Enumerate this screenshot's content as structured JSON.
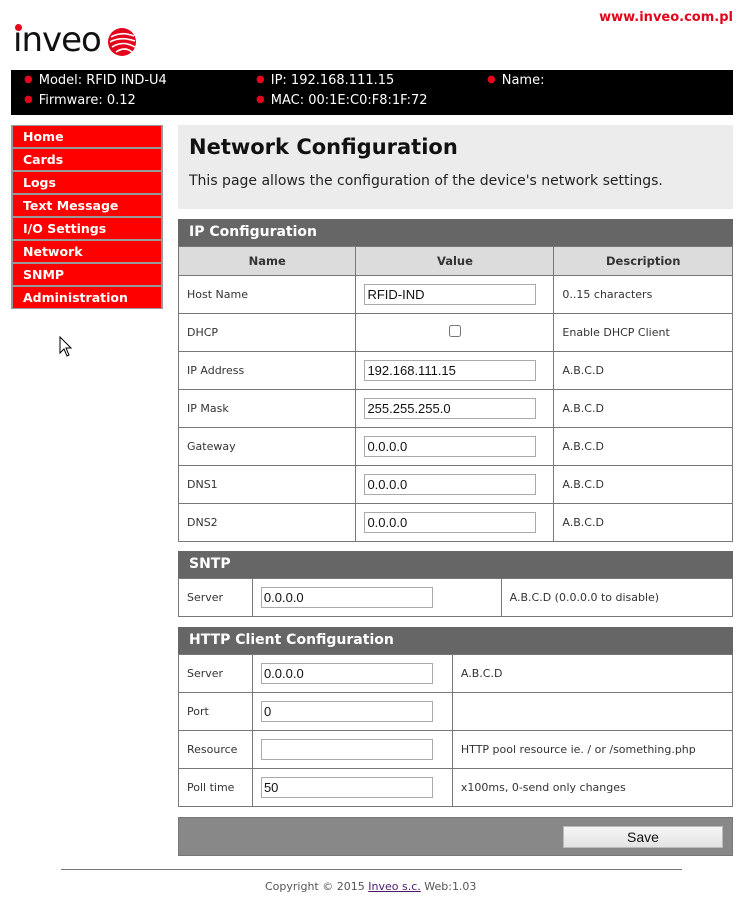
{
  "header": {
    "site_link": "www.inveo.com.pl",
    "logo_text": "inveo"
  },
  "device_info": {
    "model": "Model: RFID IND-U4",
    "firmware": "Firmware: 0.12",
    "ip": "IP: 192.168.111.15",
    "mac": "MAC: 00:1E:C0:F8:1F:72",
    "name": "Name:"
  },
  "nav": {
    "items": [
      {
        "label": "Home"
      },
      {
        "label": "Cards"
      },
      {
        "label": "Logs"
      },
      {
        "label": "Text Message"
      },
      {
        "label": "I/O Settings"
      },
      {
        "label": "Network"
      },
      {
        "label": "SNMP"
      },
      {
        "label": "Administration"
      }
    ]
  },
  "page": {
    "title": "Network Configuration",
    "description": "This page allows the configuration of the device's network settings."
  },
  "ip_config": {
    "title": "IP Configuration",
    "columns": [
      "Name",
      "Value",
      "Description"
    ],
    "rows": [
      {
        "name": "Host Name",
        "value": "RFID-IND",
        "description": "0..15 characters"
      },
      {
        "name": "DHCP",
        "checked": false,
        "description": "Enable DHCP Client"
      },
      {
        "name": "IP Address",
        "value": "192.168.111.15",
        "description": "A.B.C.D"
      },
      {
        "name": "IP Mask",
        "value": "255.255.255.0",
        "description": "A.B.C.D"
      },
      {
        "name": "Gateway",
        "value": "0.0.0.0",
        "description": "A.B.C.D"
      },
      {
        "name": "DNS1",
        "value": "0.0.0.0",
        "description": "A.B.C.D"
      },
      {
        "name": "DNS2",
        "value": "0.0.0.0",
        "description": "A.B.C.D"
      }
    ]
  },
  "sntp": {
    "title": "SNTP",
    "rows": [
      {
        "name": "Server",
        "value": "0.0.0.0",
        "description": "A.B.C.D (0.0.0.0 to disable)"
      }
    ]
  },
  "http_client": {
    "title": "HTTP Client Configuration",
    "rows": [
      {
        "name": "Server",
        "value": "0.0.0.0",
        "description": "A.B.C.D"
      },
      {
        "name": "Port",
        "value": "0",
        "description": ""
      },
      {
        "name": "Resource",
        "value": "",
        "description": "HTTP pool resource ie. / or /something.php"
      },
      {
        "name": "Poll time",
        "value": "50",
        "description": "x100ms, 0-send only changes"
      }
    ]
  },
  "actions": {
    "save_label": "Save"
  },
  "footer": {
    "copyright": "Copyright © 2015",
    "company_link": "Inveo s.c.",
    "version": "Web:1.03"
  }
}
